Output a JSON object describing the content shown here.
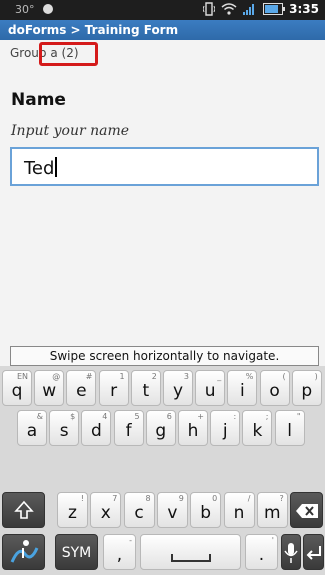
{
  "status": {
    "temperature": "30°",
    "time": "3:35",
    "battery_level": 0.8
  },
  "title": "doForms > Training Form",
  "group_label": "Group a (2)",
  "field": {
    "name": "Name",
    "hint": "Input your name",
    "value": "Ted"
  },
  "nav_hint": "Swipe screen horizontally to navigate.",
  "keyboard": {
    "row1": [
      {
        "key": "q",
        "alt": "EN"
      },
      {
        "key": "w",
        "alt": "@"
      },
      {
        "key": "e",
        "alt": "#"
      },
      {
        "key": "r",
        "alt": "1"
      },
      {
        "key": "t",
        "alt": "2"
      },
      {
        "key": "y",
        "alt": "3"
      },
      {
        "key": "u",
        "alt": "_"
      },
      {
        "key": "i",
        "alt": "%"
      },
      {
        "key": "o",
        "alt": "("
      },
      {
        "key": "p",
        "alt": ")"
      }
    ],
    "row2": [
      {
        "key": "a",
        "alt": "&"
      },
      {
        "key": "s",
        "alt": "$"
      },
      {
        "key": "d",
        "alt": "4"
      },
      {
        "key": "f",
        "alt": "5"
      },
      {
        "key": "g",
        "alt": "6"
      },
      {
        "key": "h",
        "alt": "+"
      },
      {
        "key": "j",
        "alt": ":"
      },
      {
        "key": "k",
        "alt": ";"
      },
      {
        "key": "l",
        "alt": "\""
      }
    ],
    "row3": [
      {
        "key": "z",
        "alt": "!"
      },
      {
        "key": "x",
        "alt": "7"
      },
      {
        "key": "c",
        "alt": "8"
      },
      {
        "key": "v",
        "alt": "9"
      },
      {
        "key": "b",
        "alt": "0"
      },
      {
        "key": "n",
        "alt": "/"
      },
      {
        "key": "m",
        "alt": "?"
      }
    ],
    "sym_label": "SYM",
    "comma": ",",
    "period": "."
  },
  "icons": {
    "shift": "shift-arrow-icon",
    "backspace": "backspace-icon",
    "mic": "microphone-icon",
    "enter": "enter-icon",
    "swype": "swype-icon"
  }
}
